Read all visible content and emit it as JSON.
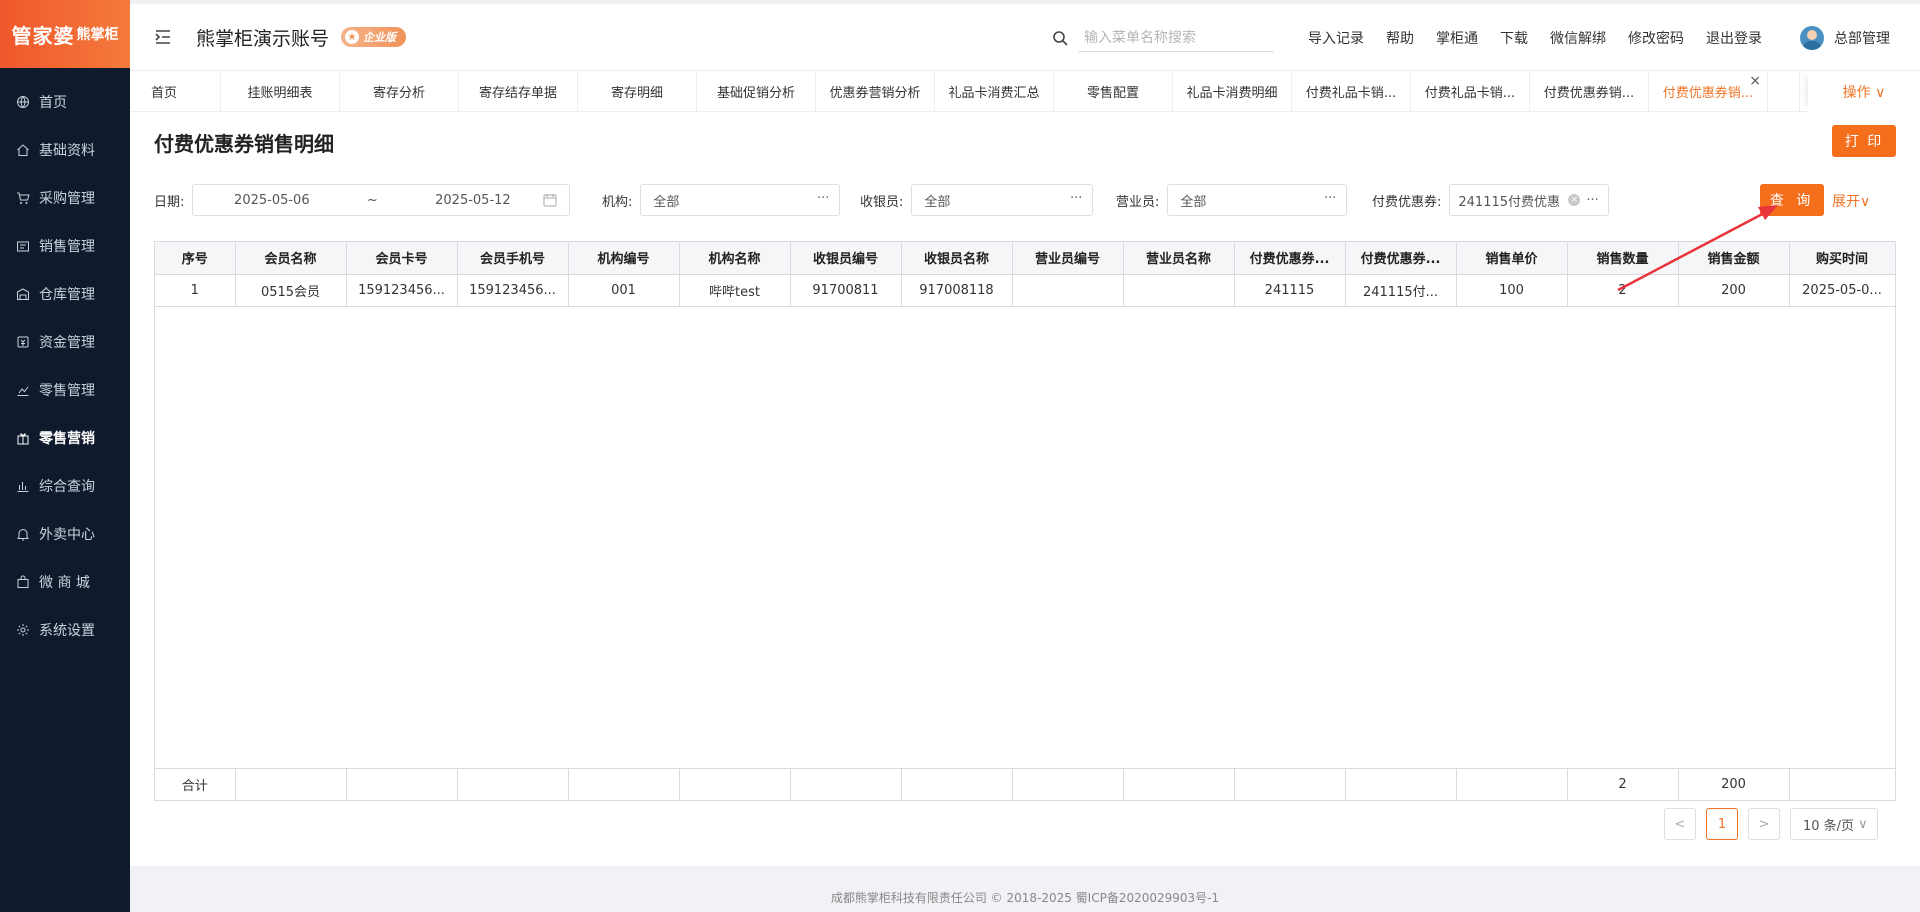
{
  "brand": {
    "logo_main": "管家婆",
    "logo_sub": "熊掌柜"
  },
  "sidebar": {
    "items": [
      {
        "label": "首页",
        "icon": "globe-icon"
      },
      {
        "label": "基础资料",
        "icon": "home-icon"
      },
      {
        "label": "采购管理",
        "icon": "cart-icon"
      },
      {
        "label": "销售管理",
        "icon": "sales-icon"
      },
      {
        "label": "仓库管理",
        "icon": "warehouse-icon"
      },
      {
        "label": "资金管理",
        "icon": "money-icon"
      },
      {
        "label": "零售管理",
        "icon": "chart-icon"
      },
      {
        "label": "零售营销",
        "icon": "gift-icon",
        "active": true
      },
      {
        "label": "综合查询",
        "icon": "bar-chart-icon"
      },
      {
        "label": "外卖中心",
        "icon": "bell-icon"
      },
      {
        "label": "微 商 城",
        "icon": "bag-icon"
      },
      {
        "label": "系统设置",
        "icon": "gear-icon"
      }
    ]
  },
  "header": {
    "account": "熊掌柜演示账号",
    "edition_badge": "企业版",
    "search_placeholder": "输入菜单名称搜索",
    "links": [
      "导入记录",
      "帮助",
      "掌柜通",
      "下载",
      "微信解绑",
      "修改密码",
      "退出登录"
    ],
    "user": "总部管理"
  },
  "tabs": {
    "items": [
      "首页",
      "挂账明细表",
      "寄存分析",
      "寄存结存单据",
      "寄存明细",
      "基础促销分析",
      "优惠券营销分析",
      "礼品卡消费汇总",
      "零售配置",
      "礼品卡消费明细",
      "付费礼品卡销...",
      "付费礼品卡销...",
      "付费优惠券销...",
      "付费优惠券销..."
    ],
    "active_index": 13,
    "ops_label": "操作 ∨"
  },
  "page": {
    "title": "付费优惠券销售明细",
    "print_label": "打 印",
    "filters": {
      "date_label": "日期:",
      "date_start": "2025-05-06",
      "date_sep": "~",
      "date_end": "2025-05-12",
      "org_label": "机构:",
      "org_value": "全部",
      "cashier_label": "收银员:",
      "cashier_value": "全部",
      "clerk_label": "营业员:",
      "clerk_value": "全部",
      "coupon_label": "付费优惠券:",
      "coupon_value": "241115付费优惠"
    },
    "query_label": "查 询",
    "expand_label": "展开∨"
  },
  "table": {
    "columns": [
      "序号",
      "会员名称",
      "会员卡号",
      "会员手机号",
      "机构编号",
      "机构名称",
      "收银员编号",
      "收银员名称",
      "营业员编号",
      "营业员名称",
      "付费优惠券...",
      "付费优惠券...",
      "销售单价",
      "销售数量",
      "销售金额",
      "购买时间"
    ],
    "rows": [
      [
        "1",
        "0515会员",
        "159123456...",
        "159123456...",
        "001",
        "哔哔test",
        "91700811",
        "917008118",
        "",
        "",
        "241115",
        "241115付...",
        "100",
        "2",
        "200",
        "2025-05-0..."
      ]
    ],
    "summary": [
      "合计",
      "",
      "",
      "",
      "",
      "",
      "",
      "",
      "",
      "",
      "",
      "",
      "",
      "2",
      "200",
      ""
    ]
  },
  "pager": {
    "prev": "<",
    "current": "1",
    "next": ">",
    "page_size": "10 条/页"
  },
  "footer": {
    "text": "成都熊掌柜科技有限责任公司 © 2018-2025 蜀ICP备2020029903号-1"
  },
  "colors": {
    "accent": "#f46e1c",
    "sidebar": "#0f1b2d",
    "annotation_arrow": "#e8343a"
  }
}
